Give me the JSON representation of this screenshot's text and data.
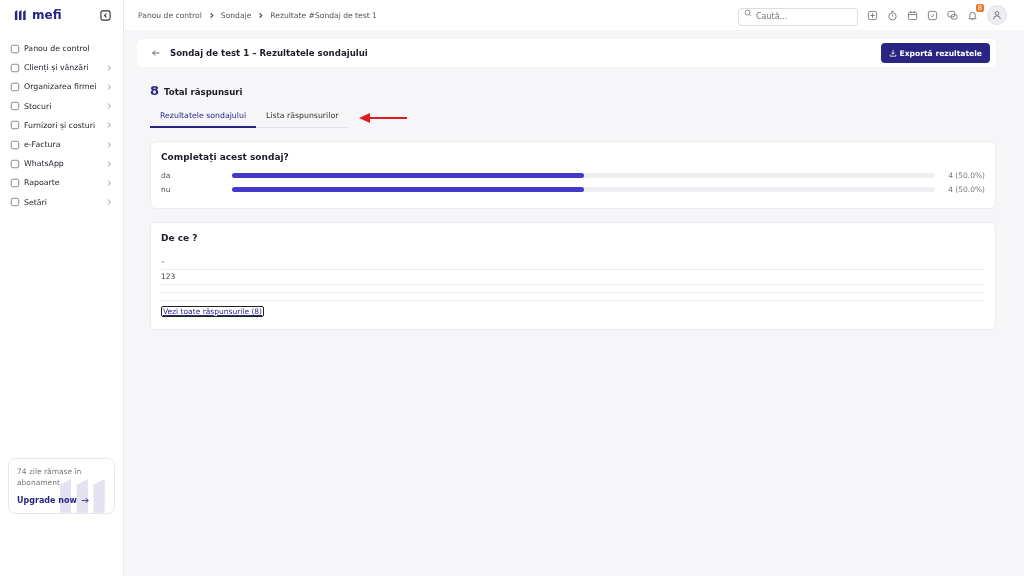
{
  "logo": {
    "text": "mefi"
  },
  "sidebar": {
    "items": [
      {
        "label": "Panou de control",
        "has_submenu": false
      },
      {
        "label": "Clienți și vânzări",
        "has_submenu": true
      },
      {
        "label": "Organizarea firmei",
        "has_submenu": true
      },
      {
        "label": "Stocuri",
        "has_submenu": true
      },
      {
        "label": "Furnizori și costuri",
        "has_submenu": true
      },
      {
        "label": "e-Factura",
        "has_submenu": true
      },
      {
        "label": "WhatsApp",
        "has_submenu": true
      },
      {
        "label": "Rapoarte",
        "has_submenu": true
      },
      {
        "label": "Setări",
        "has_submenu": true
      }
    ],
    "promo": {
      "text": "74 zile rămase în abonament",
      "link": "Upgrade now"
    }
  },
  "breadcrumbs": [
    "Panou de control",
    "Sondaje",
    "Rezultate #Sondaj de test 1"
  ],
  "search": {
    "placeholder": "Caută..."
  },
  "notifications": {
    "count": "8"
  },
  "header": {
    "title": "Sondaj de test 1 – Rezultatele sondajului",
    "export_button": "Exportă rezultatele"
  },
  "total": {
    "count": "8",
    "label": "Total răspunsuri"
  },
  "tabs": [
    {
      "label": "Rezultatele sondajului",
      "selected": true
    },
    {
      "label": "Lista răspunsurilor",
      "selected": false
    }
  ],
  "questions": [
    {
      "kind": "choice",
      "title": "Completați acest sondaj?",
      "options": [
        {
          "label": "da",
          "level": 0.5,
          "reading": "4 (50.0%)"
        },
        {
          "label": "nu",
          "level": 0.5,
          "reading": "4 (50.0%)"
        }
      ]
    },
    {
      "kind": "text",
      "title": "De ce ?",
      "answers": [
        "–",
        "123"
      ],
      "link": "Vezi toate răspunsurile (8)"
    }
  ]
}
